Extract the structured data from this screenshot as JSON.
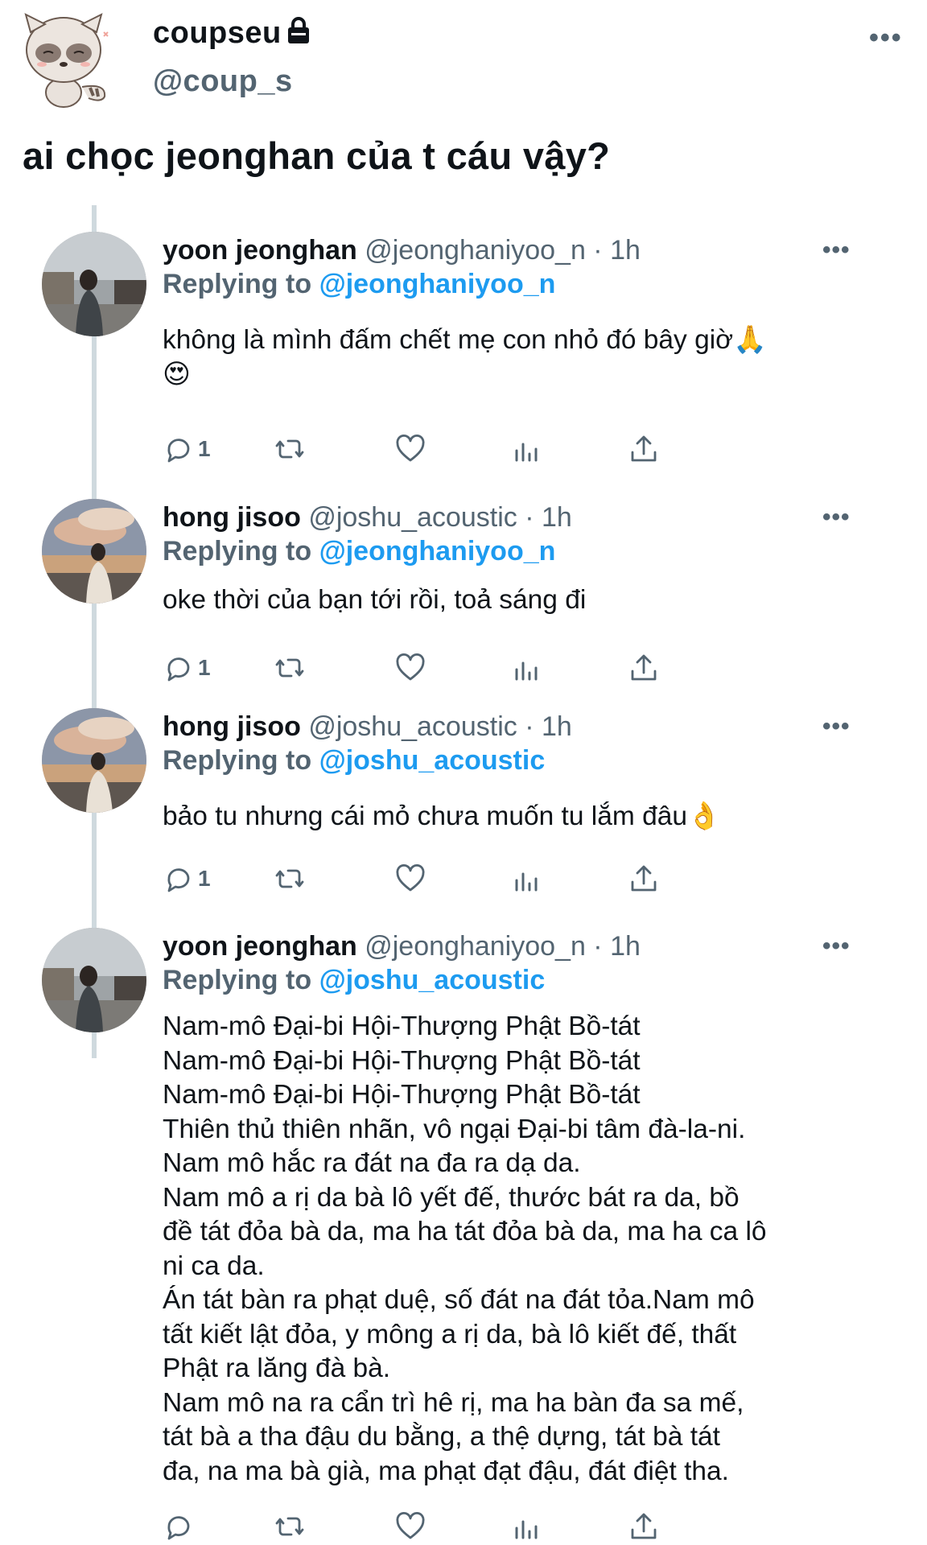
{
  "author": {
    "display_name": "coupseu",
    "handle": "@coup_s",
    "avatar": "raccoon-avatar",
    "locked": true
  },
  "more_label": "•••",
  "tweet_text": "ai chọc jeonghan của t cáu vậy?",
  "replies": [
    {
      "name": "yoon jeonghan",
      "handle": "@jeonghaniyoo_n · 1h",
      "replying_prefix": "Replying to ",
      "replying_to": "@jeonghaniyoo_n",
      "body": [
        "không là mình đấm chết mẹ con nhỏ đó bây giờ🙏",
        "😍"
      ],
      "reply_count": "1",
      "avatar": "jeonghan-avatar"
    },
    {
      "name": "hong jisoo",
      "handle": "@joshu_acoustic · 1h",
      "replying_prefix": "Replying to ",
      "replying_to": "@jeonghaniyoo_n",
      "body": [
        "oke thời của bạn tới rồi, toả sáng đi"
      ],
      "reply_count": "1",
      "avatar": "jisoo-avatar"
    },
    {
      "name": "hong jisoo",
      "handle": "@joshu_acoustic · 1h",
      "replying_prefix": "Replying to ",
      "replying_to": "@joshu_acoustic",
      "body": [
        "bảo tu nhưng cái mỏ chưa muốn tu lắm đâu👌"
      ],
      "reply_count": "1",
      "avatar": "jisoo-avatar"
    },
    {
      "name": "yoon jeonghan",
      "handle": "@jeonghaniyoo_n · 1h",
      "replying_prefix": "Replying to ",
      "replying_to": "@joshu_acoustic",
      "body": [
        "Nam-mô Đại-bi Hội-Thượng Phật Bồ-tát",
        "Nam-mô Đại-bi Hội-Thượng Phật Bồ-tát",
        "Nam-mô Đại-bi Hội-Thượng Phật Bồ-tát",
        "Thiên thủ thiên nhãn, vô ngại Đại-bi tâm đà-la-ni.",
        "Nam mô hắc ra đát na đa ra dạ da.",
        "Nam mô a rị da bà lô yết đế, thước bát ra da, bồ",
        "đề tát đỏa bà da, ma ha tát đỏa bà da, ma ha ca lô",
        "ni ca da.",
        "Án tát bàn ra phạt duệ, số đát na đát tỏa.Nam mô",
        "tất kiết lật đỏa, y mông a rị da, bà lô kiết đế, thất",
        "Phật ra lăng đà bà.",
        "Nam mô na ra cẩn trì hê rị, ma ha bàn đa sa mế,",
        "tát bà a tha đậu du bằng, a thệ dựng, tát bà tát",
        "đa, na ma bà già, ma phạt đạt đậu, đát điệt tha."
      ],
      "reply_count": "",
      "avatar": "jeonghan-avatar"
    }
  ],
  "icons": [
    "reply-icon",
    "retweet-icon",
    "like-icon",
    "analytics-icon",
    "share-icon"
  ]
}
